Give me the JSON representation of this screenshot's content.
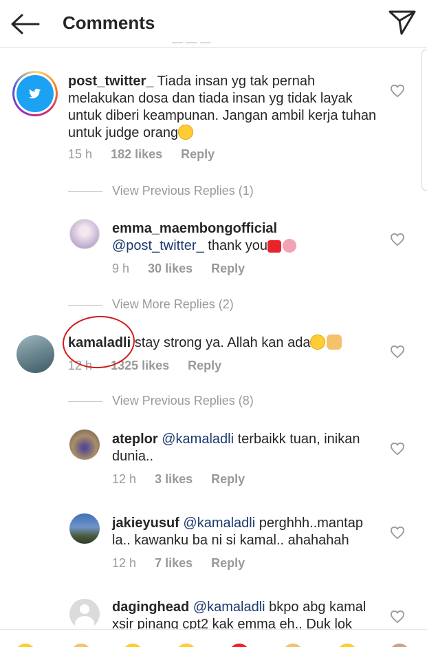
{
  "header": {
    "title": "Comments",
    "back_icon": "arrow-left-icon",
    "send_icon": "paper-plane-icon"
  },
  "comments": [
    {
      "username": "post_twitter_",
      "text": "Tiada insan yg tak pernah melakukan dosa dan tiada insan yg tidak layak untuk diberi keampunan. Jangan ambil kerja tuhan untuk judge orang",
      "time": "15 h",
      "likes": "182 likes",
      "reply": "Reply"
    }
  ],
  "view_previous_1": "View Previous Replies (1)",
  "reply_emma": {
    "username": "emma_maembongofficial",
    "mention": "@post_twitter_",
    "text": "thank you",
    "time": "9 h",
    "likes": "30 likes",
    "reply": "Reply"
  },
  "view_more": "View More Replies (2)",
  "comment_kamal": {
    "username": "kamaladli",
    "text": "stay strong ya. Allah kan ada",
    "time": "12 h",
    "likes": "1325 likes",
    "reply": "Reply"
  },
  "view_previous_8": "View Previous Replies (8)",
  "reply_ateplor": {
    "username": "ateplor",
    "mention": "@kamaladli",
    "text": "terbaikk tuan, inikan dunia..",
    "time": "12 h",
    "likes": "3 likes",
    "reply": "Reply"
  },
  "reply_jakie": {
    "username": "jakieyusuf",
    "mention": "@kamaladli",
    "text": "perghhh..mantap la.. kawanku ba ni si kamal.. ahahahah",
    "time": "12 h",
    "likes": "7 likes",
    "reply": "Reply"
  },
  "reply_daging": {
    "username": "daginghead",
    "mention": "@kamaladli",
    "text": "bkpo abg kamal xsir pinang cpt2 kak emma eh.. Duk lok"
  },
  "colors": {
    "accent_blue": "#1d3a6e",
    "meta_gray": "#999999",
    "annotation_red": "#d11a1a"
  }
}
